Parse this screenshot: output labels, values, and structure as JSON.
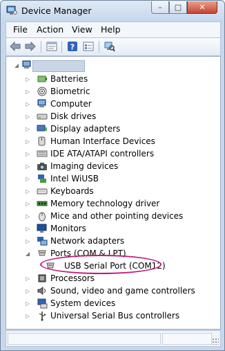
{
  "window": {
    "title": "Device Manager"
  },
  "titlebar": {
    "minimize": "–",
    "maximize": "□",
    "close": "✕"
  },
  "menu": {
    "items": [
      "File",
      "Action",
      "View",
      "Help"
    ]
  },
  "toolbar": {
    "buttons": [
      "back-icon",
      "forward-icon",
      "properties-icon",
      "help-icon",
      "view-icon",
      "scan-hardware-icon"
    ]
  },
  "tree": {
    "root": {
      "label": "",
      "icon": "computer-icon",
      "expanded": true
    },
    "categories": [
      {
        "label": "Batteries",
        "icon": "battery-icon",
        "expanded": false
      },
      {
        "label": "Biometric",
        "icon": "fingerprint-icon",
        "expanded": false
      },
      {
        "label": "Computer",
        "icon": "computer-icon",
        "expanded": false
      },
      {
        "label": "Disk drives",
        "icon": "disk-drive-icon",
        "expanded": false
      },
      {
        "label": "Display adapters",
        "icon": "display-adapter-icon",
        "expanded": false
      },
      {
        "label": "Human Interface Devices",
        "icon": "hid-icon",
        "expanded": false
      },
      {
        "label": "IDE ATA/ATAPI controllers",
        "icon": "ide-controller-icon",
        "expanded": false
      },
      {
        "label": "Imaging devices",
        "icon": "camera-icon",
        "expanded": false
      },
      {
        "label": "Intel WiUSB",
        "icon": "network-icon",
        "expanded": false
      },
      {
        "label": "Keyboards",
        "icon": "keyboard-icon",
        "expanded": false
      },
      {
        "label": "Memory technology driver",
        "icon": "memory-icon",
        "expanded": false
      },
      {
        "label": "Mice and other pointing devices",
        "icon": "mouse-icon",
        "expanded": false
      },
      {
        "label": "Monitors",
        "icon": "monitor-icon",
        "expanded": false
      },
      {
        "label": "Network adapters",
        "icon": "network-adapter-icon",
        "expanded": false
      },
      {
        "label": "Ports (COM & LPT)",
        "icon": "port-icon",
        "expanded": true,
        "children": [
          {
            "label": "USB Serial Port (COM12)",
            "icon": "port-icon"
          }
        ]
      },
      {
        "label": "Processors",
        "icon": "processor-icon",
        "expanded": false
      },
      {
        "label": "Sound, video and game controllers",
        "icon": "sound-icon",
        "expanded": false
      },
      {
        "label": "System devices",
        "icon": "system-device-icon",
        "expanded": false
      },
      {
        "label": "Universal Serial Bus controllers",
        "icon": "usb-icon",
        "expanded": false
      }
    ]
  },
  "annotation": {
    "highlight_color": "#c2187c",
    "target": "USB Serial Port (COM12)"
  },
  "colors": {
    "frame": "#c7d8ec",
    "accent": "#2a5fa8"
  }
}
